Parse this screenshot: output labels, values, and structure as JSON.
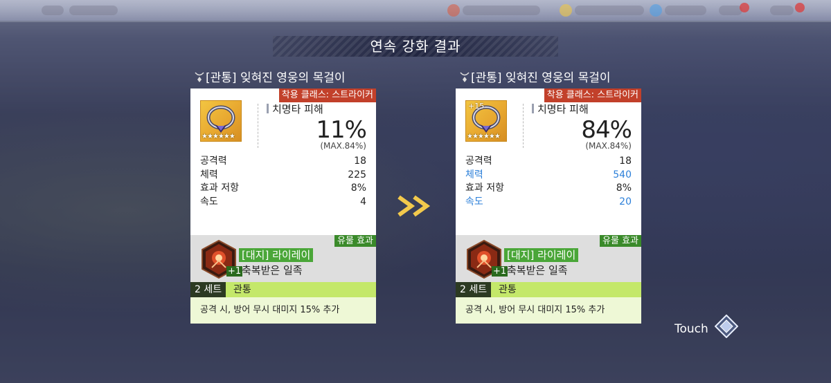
{
  "screen": {
    "title": "연속 강화 결과",
    "touch_label": "Touch"
  },
  "before": {
    "item_name": "[관통] 잊혀진 영웅의 목걸이",
    "class_tag": "착용 클래스: 스트라이커",
    "enhance_level": "",
    "stars": "★★★★★★",
    "main_stat": {
      "label": "치명타 피해",
      "value": "11%",
      "max": "(MAX.84%)"
    },
    "sub_stats": [
      {
        "label": "공격력",
        "value": "18",
        "upgraded": false
      },
      {
        "label": "체력",
        "value": "225",
        "upgraded": false
      },
      {
        "label": "효과 저항",
        "value": "8%",
        "upgraded": false
      },
      {
        "label": "속도",
        "value": "4",
        "upgraded": false
      }
    ],
    "relic": {
      "tag": "유물 효과",
      "name": "[대지] 라이레이",
      "subtitle": "축복받은 일족",
      "plus": "+1"
    },
    "set": {
      "count": "2 세트",
      "name": "관통",
      "description": "공격 시, 방어 무시 대미지 15% 추가"
    }
  },
  "after": {
    "item_name": "[관통] 잊혀진 영웅의 목걸이",
    "class_tag": "착용 클래스: 스트라이커",
    "enhance_level": "+15",
    "stars": "★★★★★★",
    "main_stat": {
      "label": "치명타 피해",
      "value": "84%",
      "max": "(MAX.84%)"
    },
    "sub_stats": [
      {
        "label": "공격력",
        "value": "18",
        "upgraded": false
      },
      {
        "label": "체력",
        "value": "540",
        "upgraded": true
      },
      {
        "label": "효과 저항",
        "value": "8%",
        "upgraded": false
      },
      {
        "label": "속도",
        "value": "20",
        "upgraded": true
      }
    ],
    "relic": {
      "tag": "유물 효과",
      "name": "[대지] 라이레이",
      "subtitle": "축복받은 일족",
      "plus": "+1"
    },
    "set": {
      "count": "2 세트",
      "name": "관통",
      "description": "공격 시, 방어 무시 대미지 15% 추가"
    }
  },
  "colors": {
    "upgrade_blue": "#2b7fd9",
    "class_tag_red": "#c2402a",
    "relic_green": "#4aa638",
    "set_lime": "#c4e86a",
    "arrow_yellow": "#f2c94c"
  }
}
